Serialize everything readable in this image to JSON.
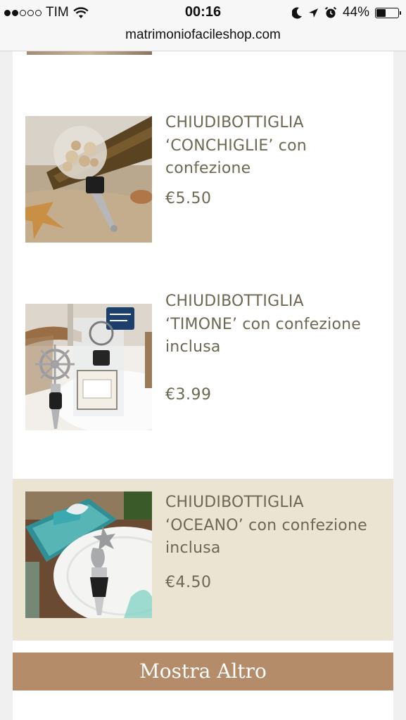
{
  "status_bar": {
    "carrier": "TIM",
    "time": "00:16",
    "battery": "44%",
    "battery_level": 0.44
  },
  "browser": {
    "url": "matrimoniofacileshop.com"
  },
  "products": [
    {
      "name": "CHIUDIBOTTIGLIA ‘CONCHIGLIE’ con confezione",
      "price": "€5.50",
      "image": "conchiglie-bottle-stopper-image"
    },
    {
      "name": "CHIUDIBOTTIGLIA ‘TIMONE’ con confezione inclusa",
      "price": "€3.99",
      "image": "timone-bottle-stopper-image"
    },
    {
      "name": "CHIUDIBOTTIGLIA ‘OCEANO’ con confezione inclusa",
      "price": "€4.50",
      "image": "oceano-bottle-stopper-image"
    }
  ],
  "load_more": {
    "label": "Mostra Altro"
  },
  "colors": {
    "text": "#6d6853",
    "highlight_bg": "#ebe4d3",
    "button_bg": "#b48c69",
    "button_text": "#ffffff"
  }
}
